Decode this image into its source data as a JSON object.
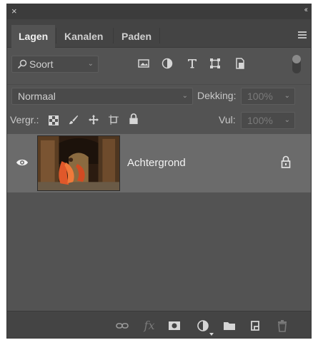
{
  "titlebar": {
    "close_glyph": "×",
    "collapse_glyph": "‹‹"
  },
  "tabs": [
    {
      "label": "Lagen",
      "active": true
    },
    {
      "label": "Kanalen",
      "active": false
    },
    {
      "label": "Paden",
      "active": false
    }
  ],
  "filter": {
    "kind_label": "Soort",
    "icons": [
      "image-filter-icon",
      "adjustment-filter-icon",
      "type-filter-icon",
      "shape-filter-icon",
      "smart-object-filter-icon"
    ]
  },
  "blend": {
    "mode": "Normaal",
    "opacity_label": "Dekking:",
    "opacity_value": "100%"
  },
  "lock": {
    "label": "Vergr.:",
    "icons": [
      "lock-transparent-pixels-icon",
      "lock-image-pixels-icon",
      "lock-position-icon",
      "lock-artboard-icon",
      "lock-all-icon"
    ],
    "fill_label": "Vul:",
    "fill_value": "100%"
  },
  "layers": [
    {
      "name": "Achtergrond",
      "visible": true,
      "locked": true
    }
  ],
  "footer": {
    "buttons": [
      "link-layers-icon",
      "fx-icon",
      "add-mask-icon",
      "adjustment-layer-icon",
      "group-folder-icon",
      "new-layer-icon",
      "delete-icon"
    ],
    "fx_label": "fx"
  },
  "colors": {
    "panel_bg": "#535353",
    "tab_bar_bg": "#444444",
    "selected_layer_bg": "#6b6b6b"
  }
}
